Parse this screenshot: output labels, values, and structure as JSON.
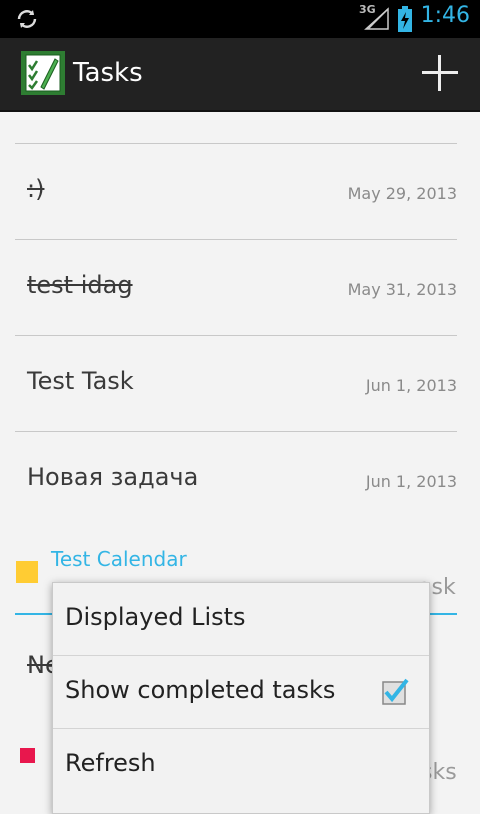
{
  "status_bar": {
    "network_label": "3G",
    "time": "1:46",
    "accent_color": "#33b5e5"
  },
  "action_bar": {
    "title": "Tasks",
    "app_icon": "checklist-icon",
    "add_icon": "plus-icon"
  },
  "tasks": [
    {
      "title": ":)",
      "date": "May 29, 2013",
      "completed": true
    },
    {
      "title": "test idag",
      "date": "May 31, 2013",
      "completed": true
    },
    {
      "title": "Test Task",
      "date": "Jun 1, 2013",
      "completed": false
    },
    {
      "title": "Новая задача",
      "date": "Jun 1, 2013",
      "completed": false
    }
  ],
  "calendars": [
    {
      "name": "Test Calendar",
      "color": "#ffcc33",
      "visible_text": "ask"
    },
    {
      "name": "",
      "color": "#e8174d",
      "visible_text": "sks",
      "partial_title": "Ne"
    }
  ],
  "overflow_menu": {
    "items": [
      {
        "label": "Displayed Lists"
      },
      {
        "label": "Show completed tasks",
        "checked": true
      },
      {
        "label": "Refresh"
      }
    ]
  }
}
